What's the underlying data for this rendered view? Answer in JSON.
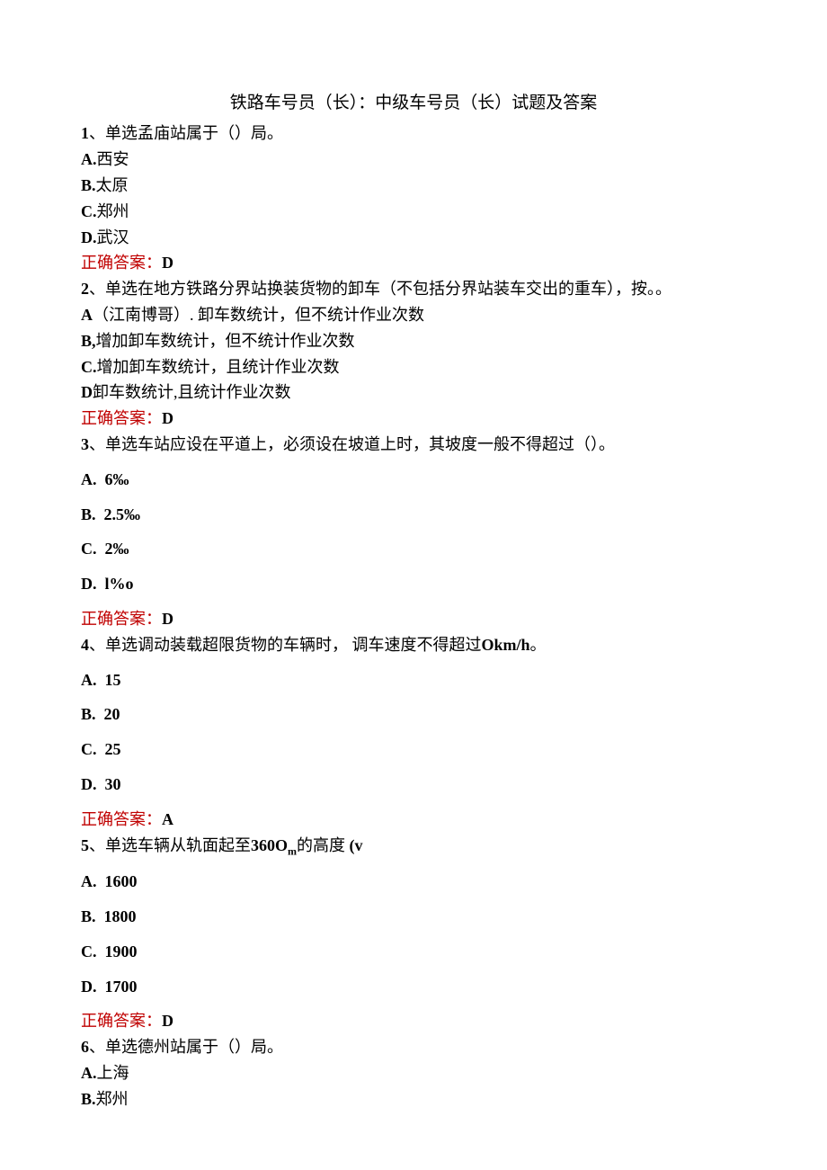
{
  "title": "铁路车号员（长）：中级车号员（长）试题及答案",
  "q1": {
    "text_prefix": "1",
    "text": "、单选孟庙站属于（）局。",
    "a": "A.",
    "a_text": "西安",
    "b": "B.",
    "b_text": "太原",
    "c": "C.",
    "c_text": "郑州",
    "d": "D.",
    "d_text": "武汉",
    "answer_label": "正确答案：",
    "answer": "D"
  },
  "q2": {
    "text_prefix": "2",
    "text": "、单选在地方铁路分界站换装货物的卸车（不包括分界站装车交出的重车），按。。",
    "a": "A",
    "a_text": "（江南博哥）. 卸车数统计，但不统计作业次数",
    "b": "B,",
    "b_text": "增加卸车数统计，但不统计作业次数",
    "c": "C.",
    "c_text": "增加卸车数统计，且统计作业次数",
    "d": "D",
    "d_text": "卸车数统计,且统计作业次数",
    "answer_label": "正确答案：",
    "answer": "D"
  },
  "q3": {
    "text_prefix": "3",
    "text": "、单选车站应设在平道上，必须设在坡道上时，其坡度一般不得超过（）。",
    "a": "A.",
    "a_text": "6‰",
    "b": "B.",
    "b_text": "2.5‰",
    "c": "C.",
    "c_text": "2‰",
    "d": "D.",
    "d_text": "l%o",
    "answer_label": "正确答案：",
    "answer": "D"
  },
  "q4": {
    "text_prefix": "4",
    "text": "、单选调动装载超限货物的车辆时， 调车速度不得超过",
    "text_bold": "Okm/h",
    "text_suffix": "。",
    "a": "A.",
    "a_text": "15",
    "b": "B.",
    "b_text": "20",
    "c": "C.",
    "c_text": "25",
    "d": "D.",
    "d_text": "30",
    "answer_label": "正确答案：",
    "answer": "A"
  },
  "q5": {
    "text_prefix": "5",
    "text_part1": "、单选车辆从轨面起至",
    "text_bold1": "360O",
    "text_sub": "m",
    "text_part2": "的高度 ",
    "text_bold2": "(v",
    "a": "A.",
    "a_text": "1600",
    "b": "B.",
    "b_text": "1800",
    "c": "C.",
    "c_text": "1900",
    "d": "D.",
    "d_text": "1700",
    "answer_label": "正确答案：",
    "answer": "D"
  },
  "q6": {
    "text_prefix": "6",
    "text": "、单选德州站属于（）局。",
    "a": "A.",
    "a_text": "上海",
    "b": "B.",
    "b_text": "郑州"
  }
}
